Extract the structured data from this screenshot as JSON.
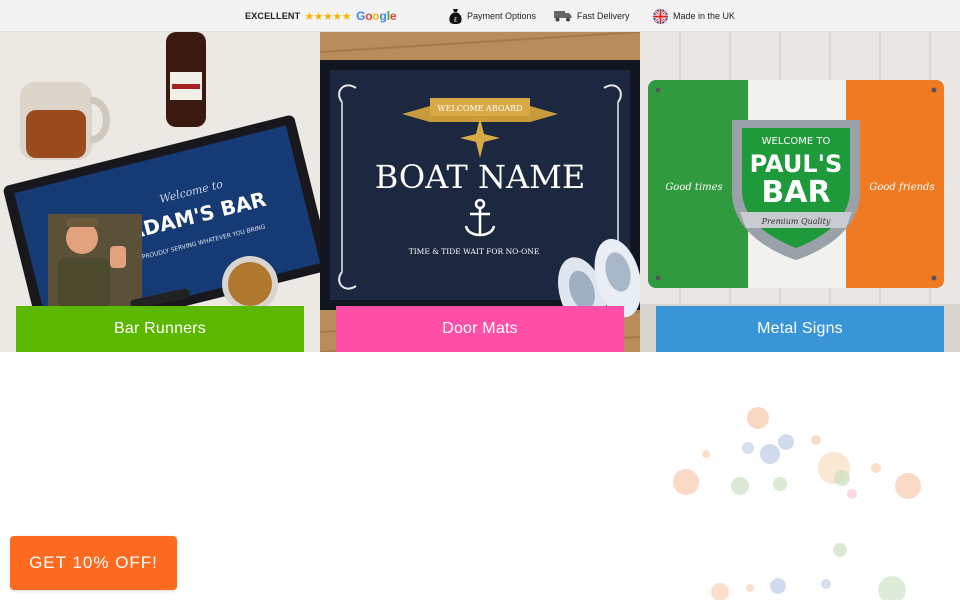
{
  "trust_bar": {
    "rating_label": "EXCELLENT",
    "stars": "★★★★★",
    "rating_source": "Google",
    "payment_label": "Payment Options",
    "delivery_label": "Fast Delivery",
    "origin_label": "Made in the UK",
    "icons": [
      "money-bag-icon",
      "delivery-truck-icon",
      "uk-flag-icon"
    ]
  },
  "tiles": [
    {
      "label": "Bar Runners",
      "color": "#5cb700",
      "image": {
        "script_line": "Welcome to",
        "headline": "ADAM'S BAR",
        "subline": "PROUDLY SERVING WHATEVER YOU BRING"
      }
    },
    {
      "label": "Door Mats",
      "color": "#ff4fa6",
      "image": {
        "banner": "WELCOME ABOARD",
        "headline": "BOAT NAME",
        "subline": "TIME & TIDE WAIT FOR NO-ONE"
      }
    },
    {
      "label": "Metal Signs",
      "color": "#3a95d6",
      "image": {
        "welcome": "WELCOME TO",
        "name": "PAUL'S",
        "venue": "BAR",
        "left_text": "Good times",
        "right_text": "Good friends",
        "ribbon": "Premium Quality"
      }
    }
  ],
  "promo": {
    "label": "GET 10% OFF!",
    "color": "#ff6a21"
  }
}
